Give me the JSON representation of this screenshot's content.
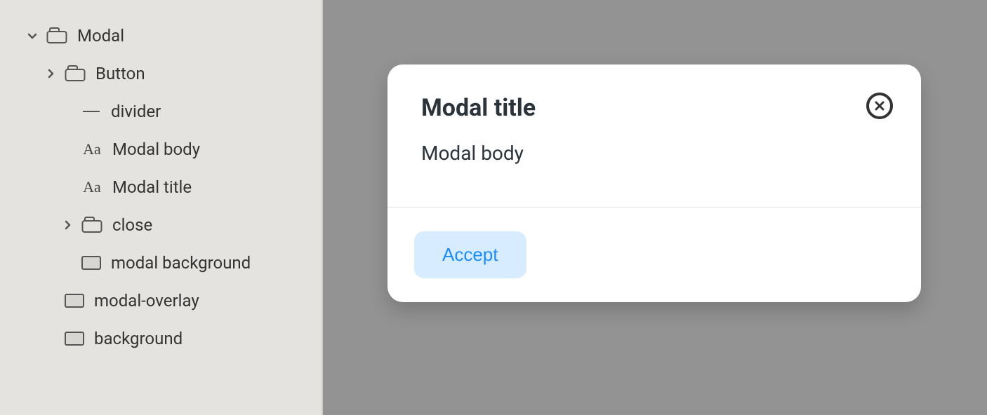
{
  "sidebar": {
    "items": [
      {
        "label": "Modal",
        "depth": 0,
        "expand": "down",
        "icon": "frame"
      },
      {
        "label": "Button",
        "depth": 1,
        "expand": "right",
        "icon": "frame"
      },
      {
        "label": "divider",
        "depth": 2,
        "expand": "none",
        "icon": "line"
      },
      {
        "label": "Modal body",
        "depth": 2,
        "expand": "none",
        "icon": "text"
      },
      {
        "label": "Modal title",
        "depth": 2,
        "expand": "none",
        "icon": "text"
      },
      {
        "label": "close",
        "depth": 2,
        "expand": "right",
        "icon": "frame"
      },
      {
        "label": "modal background",
        "depth": 2,
        "expand": "none",
        "icon": "rect"
      },
      {
        "label": "modal-overlay",
        "depth": 1,
        "expand": "none",
        "icon": "rect"
      },
      {
        "label": "background",
        "depth": 1,
        "expand": "none",
        "icon": "rect"
      }
    ]
  },
  "modal": {
    "title": "Modal title",
    "body": "Modal body",
    "accept_label": "Accept"
  }
}
